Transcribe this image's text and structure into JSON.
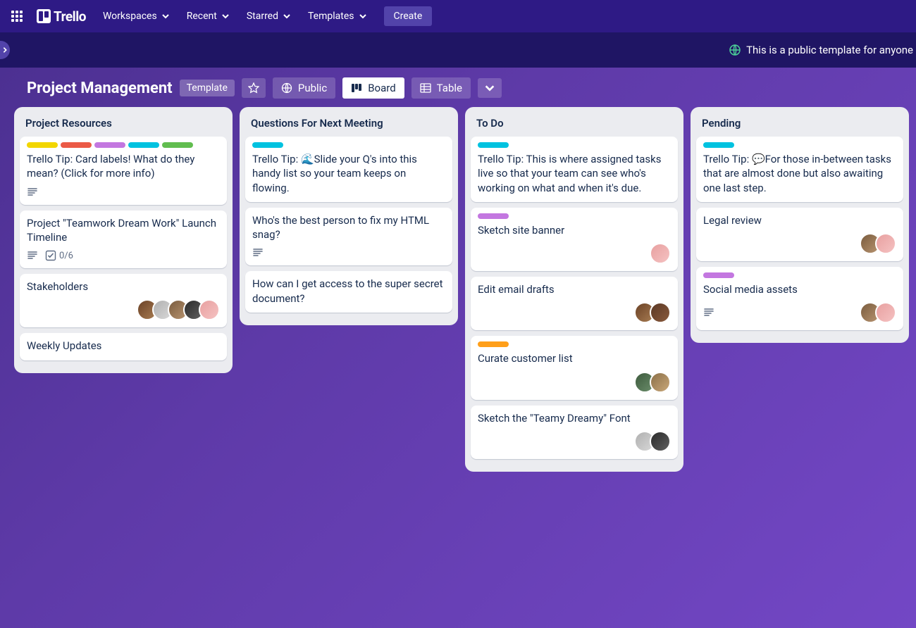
{
  "nav": {
    "logo_text": "Trello",
    "items": [
      "Workspaces",
      "Recent",
      "Starred",
      "Templates"
    ],
    "create": "Create"
  },
  "banner": {
    "text": "This is a public template for anyone"
  },
  "board_header": {
    "title": "Project Management",
    "template_badge": "Template",
    "public": "Public",
    "board": "Board",
    "table": "Table"
  },
  "label_colors": {
    "yellow": "#f2d600",
    "red": "#eb5a46",
    "purple": "#c377e0",
    "sky": "#00c2e0",
    "green": "#61bd4f",
    "orange": "#ff9f1a"
  },
  "lists": [
    {
      "title": "Project Resources",
      "cards": [
        {
          "labels": [
            "yellow",
            "red",
            "purple",
            "sky",
            "green"
          ],
          "text": "Trello Tip: Card labels! What do they mean? (Click for more info)",
          "desc": true
        },
        {
          "text": "Project \"Teamwork Dream Work\" Launch Timeline",
          "desc": true,
          "checklist": "0/6"
        },
        {
          "text": "Stakeholders",
          "members": [
            "av0",
            "av1",
            "av2",
            "av3",
            "av4"
          ]
        },
        {
          "text": "Weekly Updates"
        }
      ]
    },
    {
      "title": "Questions For Next Meeting",
      "cards": [
        {
          "labels": [
            "sky"
          ],
          "text": "Trello Tip: 🌊Slide your Q's into this handy list so your team keeps on flowing."
        },
        {
          "text": "Who's the best person to fix my HTML snag?",
          "desc": true
        },
        {
          "text": "How can I get access to the super secret document?"
        }
      ]
    },
    {
      "title": "To Do",
      "cards": [
        {
          "labels": [
            "sky"
          ],
          "text": "Trello Tip: This is where assigned tasks live so that your team can see who's working on what and when it's due."
        },
        {
          "labels": [
            "purple"
          ],
          "text": "Sketch site banner",
          "members": [
            "av4"
          ]
        },
        {
          "text": "Edit email drafts",
          "members": [
            "av0",
            "av6"
          ]
        },
        {
          "labels": [
            "orange"
          ],
          "text": "Curate customer list",
          "members": [
            "av7",
            "av5"
          ]
        },
        {
          "text": "Sketch the \"Teamy Dreamy\" Font",
          "members": [
            "av1",
            "av3"
          ]
        }
      ]
    },
    {
      "title": "Pending",
      "cards": [
        {
          "labels": [
            "sky"
          ],
          "text": "Trello Tip: 💬For those in-between tasks that are almost done but also awaiting one last step."
        },
        {
          "text": "Legal review",
          "members": [
            "av2",
            "av4"
          ]
        },
        {
          "labels": [
            "purple"
          ],
          "text": "Social media assets",
          "desc": true,
          "members": [
            "av2",
            "av4"
          ]
        }
      ]
    }
  ]
}
